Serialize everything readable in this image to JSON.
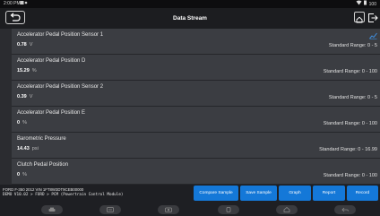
{
  "status_bar": {
    "time": "2:00 PM",
    "right": "100"
  },
  "header": {
    "title": "Data Stream"
  },
  "rows": [
    {
      "name": "Accelerator Pedal Position Sensor 1",
      "value": "0.78",
      "unit": "V",
      "range": "Standard Range:  0 - 5"
    },
    {
      "name": "Accelerator Pedal Position D",
      "value": "15.29",
      "unit": "%",
      "range": "Standard Range:  0 - 100"
    },
    {
      "name": "Accelerator Pedal Position Sensor 2",
      "value": "0.39",
      "unit": "V",
      "range": "Standard Range:  0 - 5"
    },
    {
      "name": "Accelerator Pedal Position E",
      "value": "0",
      "unit": "%",
      "range": "Standard Range:  0 - 100"
    },
    {
      "name": "Barometric Pressure",
      "value": "14.43",
      "unit": "psi",
      "range": "Standard Range:  0 - 16.99"
    },
    {
      "name": "Clutch Pedal Position",
      "value": "0",
      "unit": "%",
      "range": "Standard Range:  0 - 100"
    }
  ],
  "vehicle_info": {
    "line1": "FORD  F-350  2012  VIN  1FT8W3DT9CEB00000",
    "line2": "DEMO V10.02 > FORD > PCM (Powertrain Control Module)"
  },
  "actions": {
    "compare_sample": "Compare Sample",
    "save_sample": "Save Sample",
    "graph": "Graph",
    "report": "Report",
    "record": "Record"
  },
  "colors": {
    "accent": "#1478d8",
    "background": "#2b2c30",
    "row": "#3b3d42"
  }
}
